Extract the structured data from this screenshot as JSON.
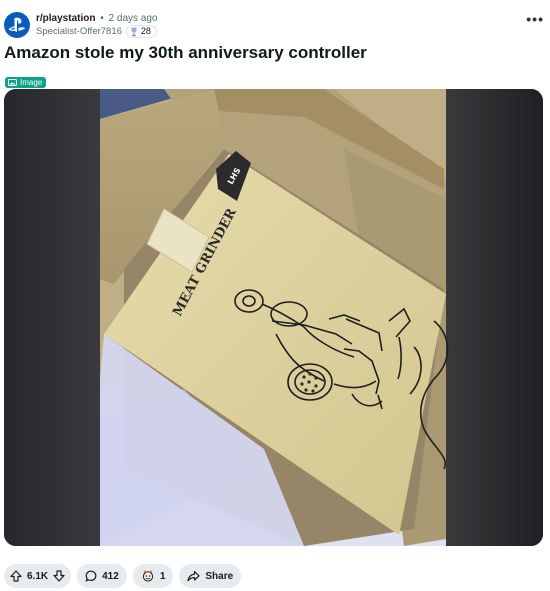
{
  "post": {
    "subreddit": "r/playstation",
    "separator": "•",
    "time_ago": "2 days ago",
    "author": "Specialist-Offer7816",
    "user_flair_count": "28",
    "more_menu": "•••",
    "title": "Amazon stole my 30th anniversary controller",
    "flair_label": "Image"
  },
  "media": {
    "box_label": "LHS",
    "product_label": "MEAT GRINDER"
  },
  "actions": {
    "upvotes": "6.1K",
    "comments": "412",
    "awards": "1",
    "share_label": "Share"
  },
  "colors": {
    "subreddit_avatar": "#0a5bbd",
    "flair_tag": "#0da389",
    "action_pill": "#e5ebee"
  },
  "icons": {
    "subreddit_avatar": "playstation-logo-icon",
    "flair": "trophy-icon",
    "flair_tag": "image-icon",
    "upvote": "arrow-up-icon",
    "downvote": "arrow-down-icon",
    "comments": "comment-bubble-icon",
    "awards": "award-icon",
    "share": "share-arrow-icon"
  }
}
